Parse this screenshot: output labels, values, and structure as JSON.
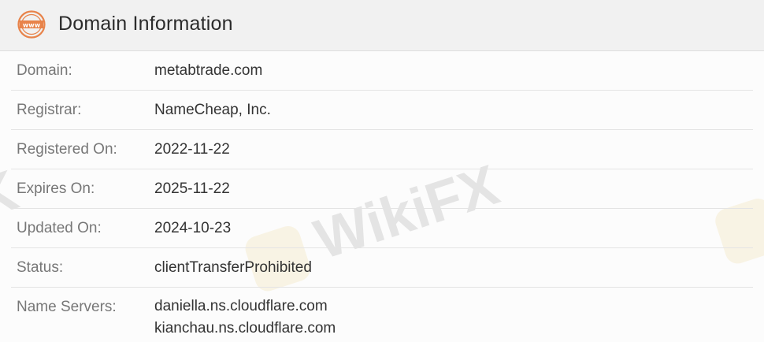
{
  "header": {
    "title": "Domain Information",
    "icon": "www-globe-icon",
    "icon_text": "www",
    "accent_color": "#e8834a"
  },
  "rows": [
    {
      "label": "Domain:",
      "value": "metabtrade.com"
    },
    {
      "label": "Registrar:",
      "value": "NameCheap, Inc."
    },
    {
      "label": "Registered On:",
      "value": "2022-11-22"
    },
    {
      "label": "Expires On:",
      "value": "2025-11-22"
    },
    {
      "label": "Updated On:",
      "value": "2024-10-23"
    },
    {
      "label": "Status:",
      "value": "clientTransferProhibited"
    }
  ],
  "name_servers": {
    "label": "Name Servers:",
    "values": [
      "daniella.ns.cloudflare.com",
      "kianchau.ns.cloudflare.com"
    ]
  },
  "watermark": {
    "text": "WikiFX"
  }
}
